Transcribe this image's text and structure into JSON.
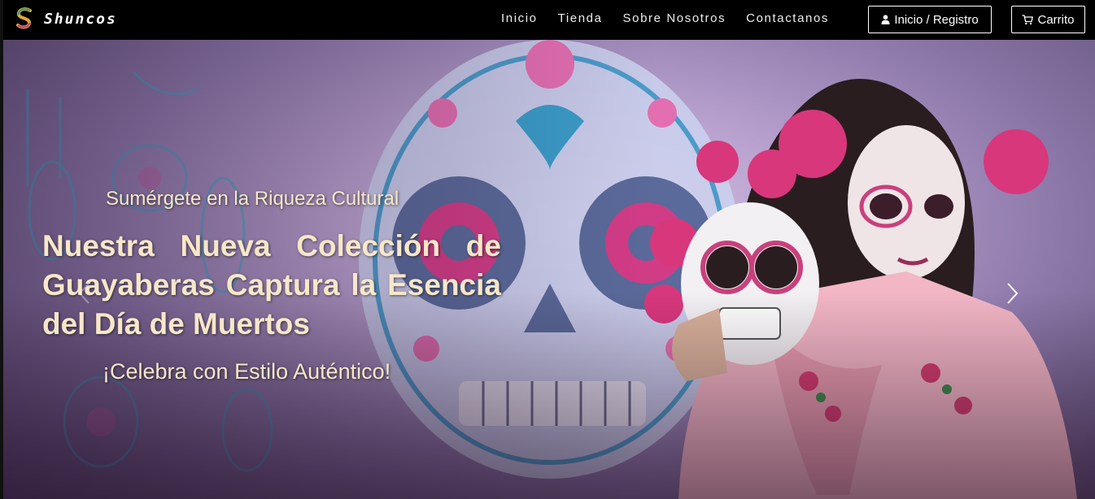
{
  "navbar": {
    "brand": "Shuncos",
    "brand_icon": "shuncos-logo-icon",
    "links": [
      {
        "label": "Inicio"
      },
      {
        "label": "Tienda"
      },
      {
        "label": "Sobre Nosotros"
      },
      {
        "label": "Contactanos"
      }
    ],
    "login_label": "Inicio / Registro",
    "login_icon": "user-icon",
    "cart_label": "Carrito",
    "cart_icon": "cart-icon"
  },
  "hero": {
    "subtitle": "Sumérgete en la Riqueza Cultural",
    "title": "Nuestra Nueva Colección de Guayaberas Captura la Esencia del Día de Muertos",
    "tagline": "¡Celebra con Estilo Auténtico!",
    "next_icon": "chevron-right-icon",
    "prev_icon": "chevron-left-icon"
  },
  "colors": {
    "navbar_bg": "#000000",
    "hero_text": "#f7e7c9",
    "accent_pink": "#e85a9c",
    "accent_blue": "#2a9bc4"
  }
}
